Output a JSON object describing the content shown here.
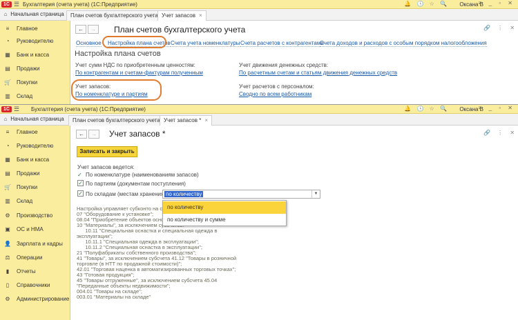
{
  "app": {
    "logo": "1С",
    "title": "Бухгалтерия (счета учета)  (1С:Предприятие)",
    "user": "Оксана В",
    "home_tab": "Начальная страница"
  },
  "win1": {
    "tabs": [
      {
        "label": "План счетов бухгалтерского учета"
      },
      {
        "label": "Учет запасов"
      }
    ],
    "sidebar": [
      {
        "icon": "≡",
        "label": "Главное"
      },
      {
        "icon": "◔",
        "label": "Руководителю"
      },
      {
        "icon": "▦",
        "label": "Банк и касса"
      },
      {
        "icon": "▤",
        "label": "Продажи"
      },
      {
        "icon": "🛒",
        "label": "Покупки"
      },
      {
        "icon": "▥",
        "label": "Склад"
      }
    ],
    "header": {
      "title": "План счетов бухгалтерского учета",
      "back": "←",
      "fwd": "→"
    },
    "nav_links": [
      "Основное",
      "Настройка плана счетов",
      "Счета учета номенклатуры",
      "Счета расчетов с контрагентами",
      "Счета доходов и расходов с особым порядком налогообложения"
    ],
    "section_title": "Настройка плана счетов",
    "vat_label": "Учет сумм НДС по приобретенным ценностям:",
    "vat_value": "По контрагентам и счетам-фактурам полученным",
    "cash_label": "Учет движения денежных средств:",
    "cash_value": "По расчетным счетам и статьям движения денежных средств",
    "stock_label": "Учет запасов:",
    "stock_value": "По номенклатуре и партиям",
    "pers_label": "Учет расчетов с персоналом:",
    "pers_value": "Сводно по всем работникам"
  },
  "win2": {
    "tabs": [
      {
        "label": "План счетов бухгалтерского учета"
      },
      {
        "label": "Учет запасов *"
      }
    ],
    "sidebar": [
      {
        "icon": "≡",
        "label": "Главное"
      },
      {
        "icon": "◔",
        "label": "Руководителю"
      },
      {
        "icon": "▦",
        "label": "Банк и касса"
      },
      {
        "icon": "▤",
        "label": "Продажи"
      },
      {
        "icon": "🛒",
        "label": "Покупки"
      },
      {
        "icon": "▥",
        "label": "Склад"
      },
      {
        "icon": "⚙",
        "label": "Производство"
      },
      {
        "icon": "▣",
        "label": "ОС и НМА"
      },
      {
        "icon": "👤",
        "label": "Зарплата и кадры"
      },
      {
        "icon": "⚖",
        "label": "Операции"
      },
      {
        "icon": "▮",
        "label": "Отчеты"
      },
      {
        "icon": "▯",
        "label": "Справочники"
      },
      {
        "icon": "⚙",
        "label": "Администрирование"
      }
    ],
    "header": {
      "title": "Учет запасов *",
      "back": "←",
      "fwd": "→"
    },
    "save_button": "Записать и закрыть",
    "intro": "Учет запасов ведется:",
    "opt1": "По номенклатуре (наименованиям запасов)",
    "opt2": "По партиям (документам поступления)",
    "opt3": "По складам (местам хранения):",
    "select_value": "по количеству",
    "dropdown": [
      "по количеству",
      "по количеству и сумме"
    ],
    "text_lines": [
      "Настройка управляет субконто на сче",
      "07 \"Оборудование к установке\";",
      "08.04 \"Приобретение объектов основ",
      "10 \"Материалы\", за исключением субсчетов:",
      "      10.11 \"Специальная оснастка и специальная одежда в",
      "эксплуатации\";",
      "      10.11.1 \"Специальная одежда в эксплуатации\";",
      "      10.11.2 \"Специальная оснастка в эксплуатации\";",
      "21 \"Полуфабрикаты собственного производства\";",
      "41 \"Товары\", за исключением субсчета 41.12 \"Товары в розничной",
      "торговле (в НТТ по продажной стоимости)\";",
      "42.01 \"Торговая наценка в автоматизированных торговых точках\";",
      "43 \"Готовая продукция\";",
      "45 \"Товары отгруженные\", за исключением субсчета 45.04",
      "\"Переданные объекты недвижимости\";",
      "004.01 \"Товары на складе\";",
      "003.01 \"Материалы на складе\""
    ]
  }
}
